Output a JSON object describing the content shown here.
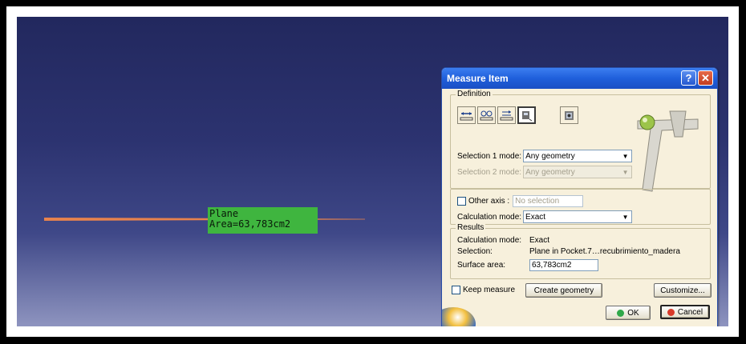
{
  "viewport": {
    "plane_label": {
      "line1": "Plane",
      "line2": "Area=63,783cm2"
    }
  },
  "dialog": {
    "title": "Measure Item",
    "help_label": "?",
    "close_label": "✕",
    "definition": {
      "title": "Definition",
      "tools": [
        "measure-between-icon",
        "measure-thickness-icon",
        "measure-between-chain-icon",
        "measure-item-icon",
        "measure-inertia-icon"
      ],
      "selection1_label": "Selection 1 mode:",
      "selection1_value": "Any geometry",
      "selection2_label": "Selection 2 mode:",
      "selection2_value": "Any geometry",
      "other_axis_label": "Other axis :",
      "other_axis_value": "No selection",
      "calc_mode_label": "Calculation mode:",
      "calc_mode_value": "Exact"
    },
    "results": {
      "title": "Results",
      "rows": [
        {
          "key": "Calculation mode:",
          "value": "Exact"
        },
        {
          "key": "Selection:",
          "value": "Plane in Pocket.7…recubrimiento_madera"
        }
      ],
      "surface_area_label": "Surface area:",
      "surface_area_value": "63,783cm2"
    },
    "keep_measure_label": "Keep measure",
    "create_geometry_label": "Create geometry",
    "customize_label": "Customize...",
    "ok_label": "OK",
    "cancel_label": "Cancel",
    "colors": {
      "title_bar": "#1f5fdb",
      "plane_label_bg": "#3fb53f",
      "plane_edge": "#e8834d"
    }
  }
}
